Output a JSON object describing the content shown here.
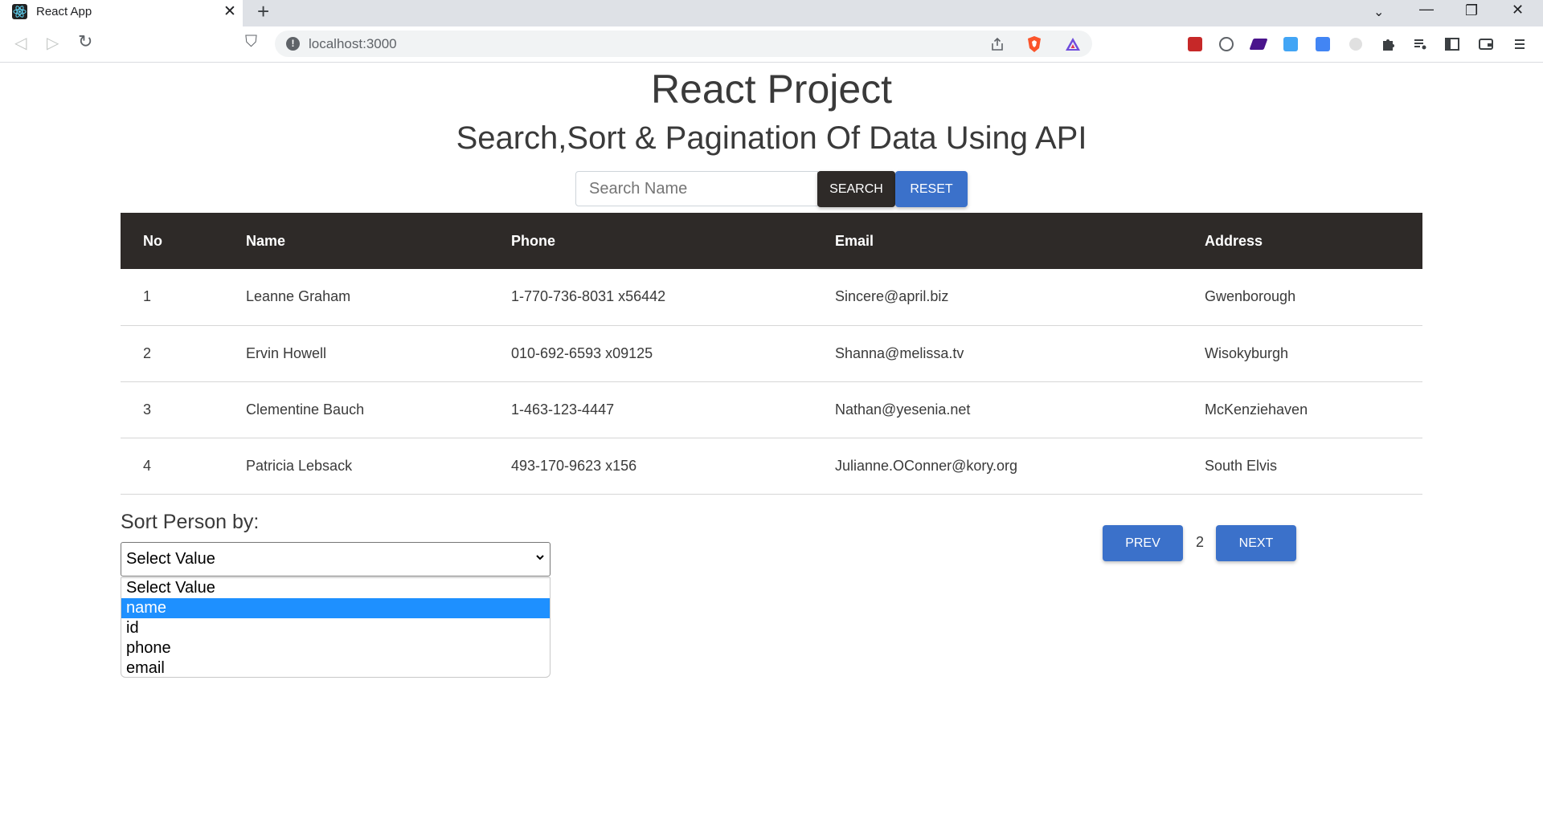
{
  "browser": {
    "tab_title": "React App",
    "url": "localhost:3000",
    "close_glyph": "✕",
    "new_tab_glyph": "+",
    "back_glyph": "◁",
    "forward_glyph": "▷",
    "reload_glyph": "↻",
    "bookmark_glyph": "⛉",
    "minimize_glyph": "—",
    "restore_glyph": "❐",
    "win_close_glyph": "✕",
    "tabsearch_glyph": "⌄",
    "accent": "#4285f4"
  },
  "page": {
    "title": "React Project",
    "subtitle": "Search,Sort & Pagination Of Data Using API"
  },
  "search": {
    "placeholder": "Search Name",
    "value": "",
    "search_label": "SEARCH",
    "reset_label": "RESET"
  },
  "table": {
    "headers": [
      "No",
      "Name",
      "Phone",
      "Email",
      "Address"
    ],
    "rows": [
      {
        "no": "1",
        "name": "Leanne Graham",
        "phone": "1-770-736-8031 x56442",
        "email": "Sincere@april.biz",
        "address": "Gwenborough"
      },
      {
        "no": "2",
        "name": "Ervin Howell",
        "phone": "010-692-6593 x09125",
        "email": "Shanna@melissa.tv",
        "address": "Wisokyburgh"
      },
      {
        "no": "3",
        "name": "Clementine Bauch",
        "phone": "1-463-123-4447",
        "email": "Nathan@yesenia.net",
        "address": "McKenziehaven"
      },
      {
        "no": "4",
        "name": "Patricia Lebsack",
        "phone": "493-170-9623 x156",
        "email": "Julianne.OConner@kory.org",
        "address": "South Elvis"
      }
    ]
  },
  "sort": {
    "label": "Sort Person by:",
    "selected": "Select Value",
    "options": [
      "Select Value",
      "name",
      "id",
      "phone",
      "email"
    ],
    "highlighted_option": "name"
  },
  "pagination": {
    "prev_label": "PREV",
    "current_page": "2",
    "next_label": "NEXT"
  },
  "colors": {
    "dark": "#2e2a28",
    "primary": "#3b71ca",
    "highlight": "#1e90ff"
  }
}
